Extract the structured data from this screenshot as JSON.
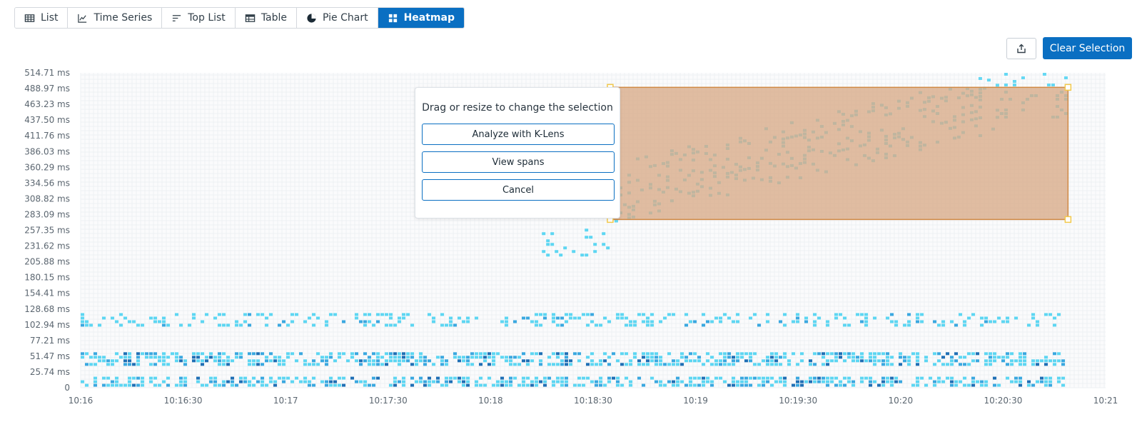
{
  "tabs": [
    {
      "label": "List",
      "icon": "list-icon",
      "active": false
    },
    {
      "label": "Time Series",
      "icon": "line-chart-icon",
      "active": false
    },
    {
      "label": "Top List",
      "icon": "top-list-icon",
      "active": false
    },
    {
      "label": "Table",
      "icon": "table-icon",
      "active": false
    },
    {
      "label": "Pie Chart",
      "icon": "pie-chart-icon",
      "active": false
    },
    {
      "label": "Heatmap",
      "icon": "heatmap-icon",
      "active": true
    }
  ],
  "toolbar": {
    "share_icon": "share-icon",
    "clear_selection_label": "Clear Selection"
  },
  "selection_popup": {
    "message": "Drag or resize to change the selection",
    "analyze_label": "Analyze with K-Lens",
    "view_spans_label": "View spans",
    "cancel_label": "Cancel"
  },
  "colors": {
    "accent": "#0a6fc2",
    "selection_fill": "#d9aa87",
    "selection_border": "#d08a45",
    "handle": "#f2c94c",
    "cell_light": "#5dd6f2",
    "cell_mid": "#3aa8e0",
    "cell_dark": "#1f6fb5"
  },
  "chart_data": {
    "type": "heatmap",
    "x_tick_labels": [
      "10:16",
      "10:16:30",
      "10:17",
      "10:17:30",
      "10:18",
      "10:18:30",
      "10:19",
      "10:19:30",
      "10:20",
      "10:20:30",
      "10:21"
    ],
    "y_tick_labels": [
      "0",
      "25.74 ms",
      "51.47 ms",
      "77.21 ms",
      "102.94 ms",
      "128.68 ms",
      "154.41 ms",
      "180.15 ms",
      "205.88 ms",
      "231.62 ms",
      "257.35 ms",
      "283.09 ms",
      "308.82 ms",
      "334.56 ms",
      "360.29 ms",
      "386.03 ms",
      "411.76 ms",
      "437.50 ms",
      "463.23 ms",
      "488.97 ms",
      "514.71 ms"
    ],
    "xlim": [
      "10:16",
      "10:21"
    ],
    "ylim_ms": [
      0,
      514.71
    ],
    "grid": true,
    "selection": {
      "time_start": "10:18:35",
      "time_end": "10:20:49",
      "latency_start_ms": 275,
      "latency_end_ms": 491
    },
    "bands": [
      {
        "latency_ms_range": [
          0,
          18
        ],
        "time_range": [
          "10:16",
          "10:20:49"
        ],
        "intensity": "high"
      },
      {
        "latency_ms_range": [
          30,
          58
        ],
        "time_range": [
          "10:16",
          "10:20:49"
        ],
        "intensity": "high"
      },
      {
        "latency_ms_range": [
          98,
          122
        ],
        "time_range": [
          "10:16",
          "10:20:49"
        ],
        "intensity": "medium"
      },
      {
        "latency_ms_range": [
          210,
          260
        ],
        "time_range": [
          "10:18:15",
          "10:18:35"
        ],
        "intensity": "low"
      },
      {
        "latency_ms_range": [
          280,
          514
        ],
        "time_range": [
          "10:18:35",
          "10:20:49"
        ],
        "intensity": "low",
        "trend": "rising"
      }
    ]
  }
}
